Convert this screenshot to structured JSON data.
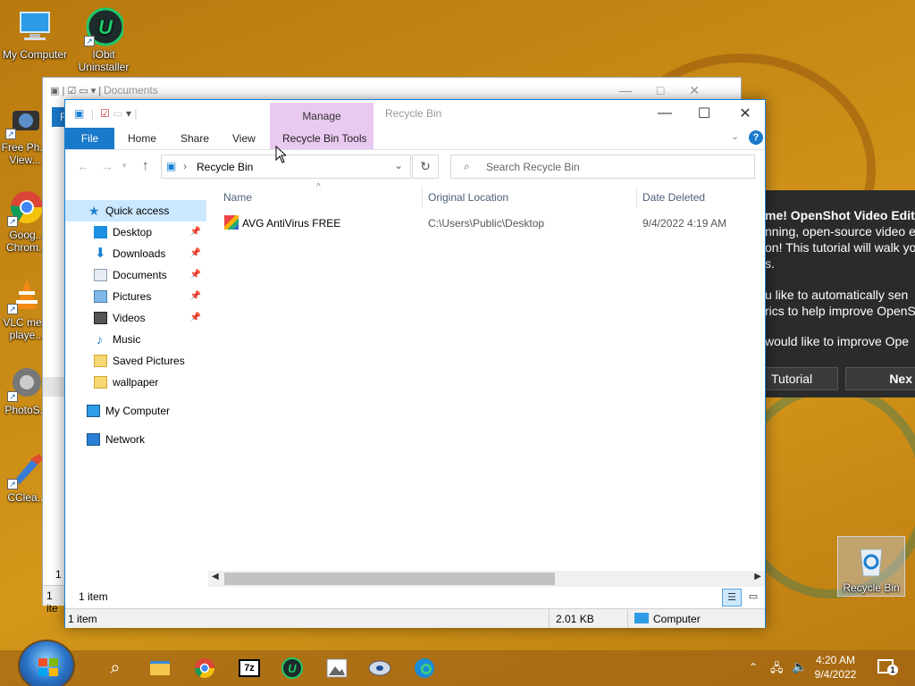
{
  "desktop": {
    "icons": [
      {
        "label": "My Computer"
      },
      {
        "label": "IObit Uninstaller"
      },
      {
        "label": "Free Ph... View..."
      },
      {
        "label": "Goog... Chrom..."
      },
      {
        "label": "VLC me... playe..."
      },
      {
        "label": "PhotoS..."
      },
      {
        "label": "CClea..."
      },
      {
        "label": "Recycle Bin"
      }
    ]
  },
  "openshot": {
    "lines": [
      "me! OpenShot Video Editor",
      "nning, open-source video e",
      "on! This tutorial will walk yo",
      "s.",
      "u like to automatically sen",
      "rics to help improve OpenS",
      "would like to improve Ope"
    ],
    "tutorial_button": "Tutorial",
    "next_button": "Nex"
  },
  "back_window": {
    "title": "Documents",
    "file_tab": "F",
    "status_count": "1 i",
    "status_count2": "1 ite"
  },
  "window": {
    "title": "Recycle Bin",
    "context_group": "Manage",
    "tabs": {
      "file": "File",
      "home": "Home",
      "share": "Share",
      "view": "View",
      "tools": "Recycle Bin Tools"
    },
    "address": "Recycle Bin",
    "search_placeholder": "Search Recycle Bin",
    "nav": {
      "quick_access": "Quick access",
      "desktop": "Desktop",
      "downloads": "Downloads",
      "documents": "Documents",
      "pictures": "Pictures",
      "videos": "Videos",
      "music": "Music",
      "saved_pictures": "Saved Pictures",
      "wallpaper": "wallpaper",
      "my_computer": "My Computer",
      "network": "Network"
    },
    "columns": {
      "name": "Name",
      "original_location": "Original Location",
      "date_deleted": "Date Deleted"
    },
    "rows": [
      {
        "name": "AVG AntiVirus FREE",
        "location": "C:\\Users\\Public\\Desktop",
        "date": "9/4/2022 4:19 AM"
      }
    ],
    "item_count": "1 item",
    "status_count": "1 item",
    "status_size": "2.01 KB",
    "status_location": "Computer"
  },
  "taskbar": {
    "time": "4:20 AM",
    "date": "9/4/2022",
    "notification_count": "1"
  },
  "colors": {
    "accent": "#1979ca",
    "context_tab": "#e8c9f0"
  }
}
